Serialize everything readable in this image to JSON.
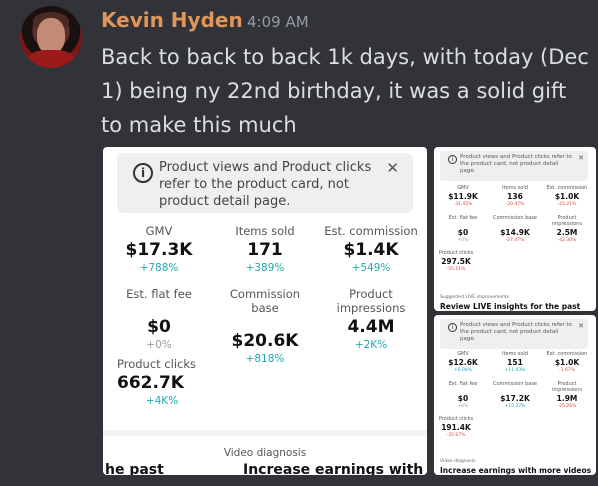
{
  "message": {
    "author": "Kevin Hyden",
    "time": "4:09 AM",
    "text": "Back to back to back 1k days, with today (Dec 1) being ny 22nd birthday, it was a solid gift to make this much"
  },
  "images": {
    "main": {
      "notice": "Product views and Product clicks refer to the product card, not product detail page.",
      "close": "✕",
      "metrics": [
        {
          "label": "GMV",
          "value": "$17.3K",
          "change": "+788%"
        },
        {
          "label": "Items sold",
          "value": "171",
          "change": "+389%"
        },
        {
          "label": "Est. commission",
          "value": "$1.4K",
          "change": "+549%"
        },
        {
          "label": "Est. flat fee",
          "value": "$0",
          "change": "+0%"
        },
        {
          "label": "Commission base",
          "value": "$20.6K",
          "change": "+818%"
        },
        {
          "label": "Product impressions",
          "value": "4.4M",
          "change": "+2K%"
        },
        {
          "label": "Product clicks",
          "value": "662.7K",
          "change": "+4K%"
        }
      ],
      "footer_label": "Video diagnosis",
      "cut_left": "he past",
      "cut_mid": "Increase earnings with m"
    },
    "right_top": {
      "notice": "Product views and Product clicks refer to the product card, not product detail page.",
      "close": "✕",
      "metrics": [
        {
          "label": "GMV",
          "value": "$11.9K",
          "change": "-31.45%"
        },
        {
          "label": "Items sold",
          "value": "136",
          "change": "-20.47%"
        },
        {
          "label": "Est. commission",
          "value": "$1.0K",
          "change": "-25.21%"
        },
        {
          "label": "Est. flat fee",
          "value": "$0",
          "change": "+0%"
        },
        {
          "label": "Commission base",
          "value": "$14.9K",
          "change": "-27.47%"
        },
        {
          "label": "Product impressions",
          "value": "2.5M",
          "change": "-42.30%"
        },
        {
          "label": "Product clicks",
          "value": "297.5K",
          "change": "-55.11%"
        }
      ],
      "footer_label": "Suggested LIVE improvements",
      "footer_title": "Review LIVE insights for the past"
    },
    "right_bottom": {
      "notice": "Product views and Product clicks refer to the product card, not product detail page.",
      "close": "✕",
      "metrics": [
        {
          "label": "GMV",
          "value": "$12.6K",
          "change": "+6.09%"
        },
        {
          "label": "Items sold",
          "value": "151",
          "change": "+11.03%"
        },
        {
          "label": "Est. commission",
          "value": "$1.0K",
          "change": "-1.67%"
        },
        {
          "label": "Est. flat fee",
          "value": "$0",
          "change": "+0%"
        },
        {
          "label": "Commission base",
          "value": "$17.2K",
          "change": "+15.27%"
        },
        {
          "label": "Product impressions",
          "value": "1.9M",
          "change": "-25.26%"
        },
        {
          "label": "Product clicks",
          "value": "191.4K",
          "change": "-35.67%"
        }
      ],
      "footer_label": "Video diagnosis",
      "footer_title": "Increase earnings with more videos"
    }
  }
}
